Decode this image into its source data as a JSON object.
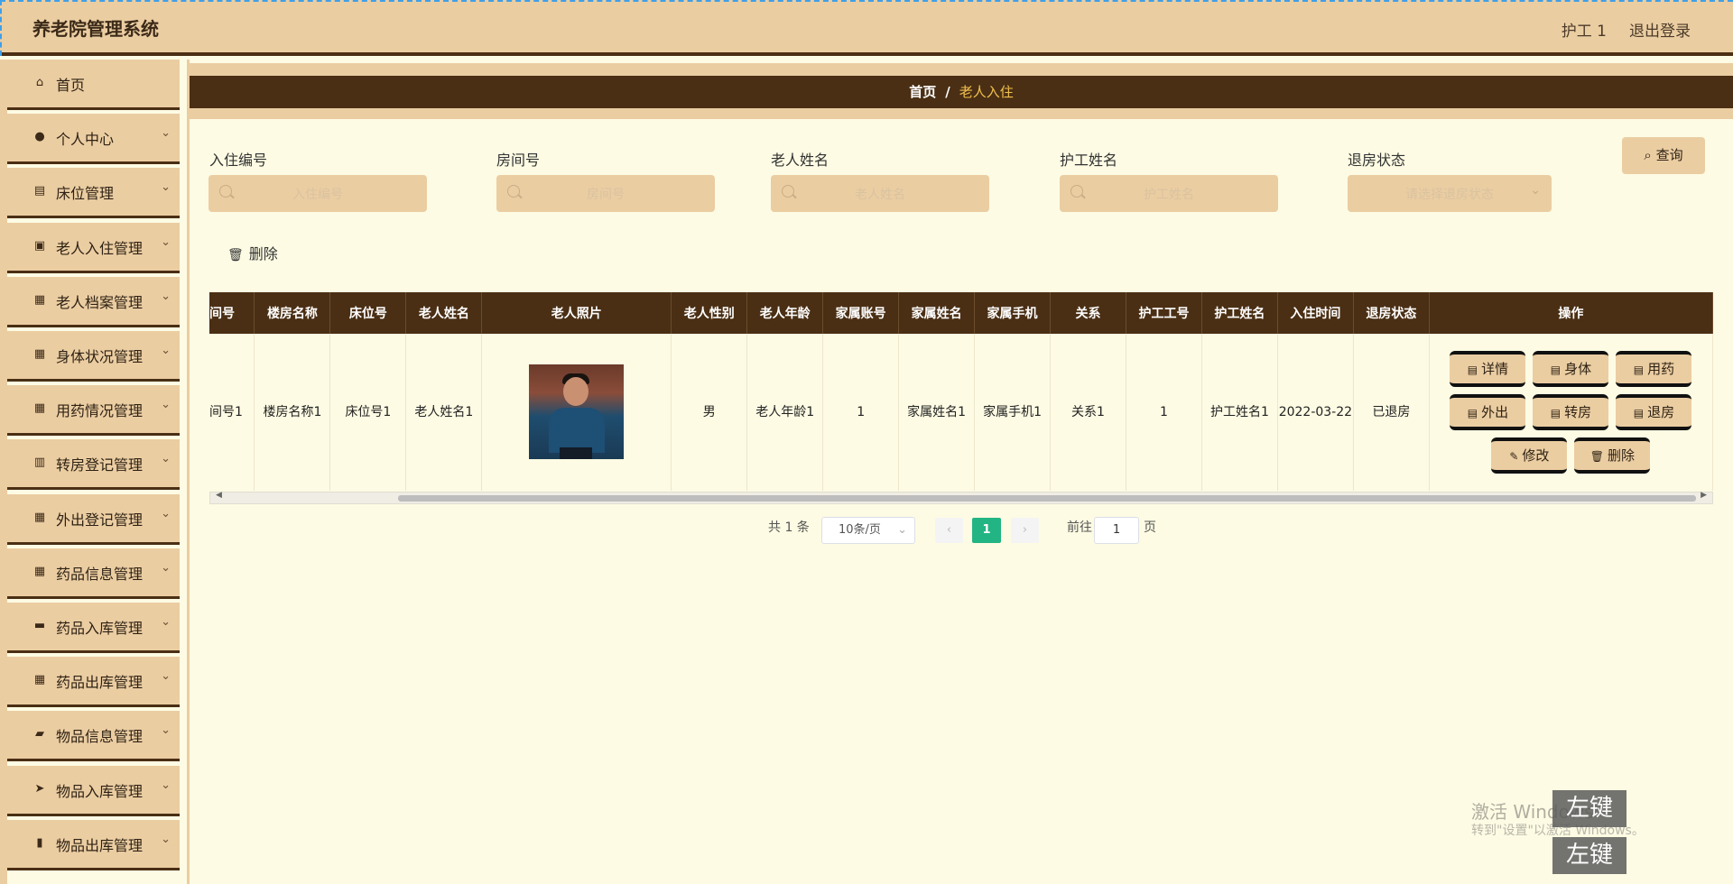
{
  "header": {
    "app_title": "养老院管理系统",
    "user": "护工 1",
    "logout": "退出登录"
  },
  "sidebar": {
    "items": [
      {
        "label": "首页",
        "icon": "home-icon",
        "glyph": "⌂",
        "has_chevron": false
      },
      {
        "label": "个人中心",
        "icon": "user-icon",
        "glyph": "●",
        "has_chevron": true
      },
      {
        "label": "床位管理",
        "icon": "chart-icon",
        "glyph": "▤",
        "has_chevron": true
      },
      {
        "label": "老人入住管理",
        "icon": "clipboard-icon",
        "glyph": "▣",
        "has_chevron": true
      },
      {
        "label": "老人档案管理",
        "icon": "grid-icon",
        "glyph": "▦",
        "has_chevron": true
      },
      {
        "label": "身体状况管理",
        "icon": "grid-icon",
        "glyph": "▦",
        "has_chevron": true
      },
      {
        "label": "用药情况管理",
        "icon": "grid-icon",
        "glyph": "▦",
        "has_chevron": true
      },
      {
        "label": "转房登记管理",
        "icon": "library-icon",
        "glyph": "▥",
        "has_chevron": true
      },
      {
        "label": "外出登记管理",
        "icon": "grid-icon",
        "glyph": "▦",
        "has_chevron": true
      },
      {
        "label": "药品信息管理",
        "icon": "grid-icon",
        "glyph": "▦",
        "has_chevron": true
      },
      {
        "label": "药品入库管理",
        "icon": "monitor-icon",
        "glyph": "▬",
        "has_chevron": true
      },
      {
        "label": "药品出库管理",
        "icon": "grid-icon",
        "glyph": "▦",
        "has_chevron": true
      },
      {
        "label": "物品信息管理",
        "icon": "briefcase-icon",
        "glyph": "▰",
        "has_chevron": true
      },
      {
        "label": "物品入库管理",
        "icon": "send-icon",
        "glyph": "➤",
        "has_chevron": true
      },
      {
        "label": "物品出库管理",
        "icon": "clipboard-icon",
        "glyph": "▮",
        "has_chevron": true
      }
    ]
  },
  "breadcrumb": {
    "home": "首页",
    "separator": "/",
    "current": "老人入住"
  },
  "search": {
    "fields": [
      {
        "label": "入住编号",
        "placeholder": "入住编号",
        "type": "text"
      },
      {
        "label": "房间号",
        "placeholder": "房间号",
        "type": "text"
      },
      {
        "label": "老人姓名",
        "placeholder": "老人姓名",
        "type": "text"
      },
      {
        "label": "护工姓名",
        "placeholder": "护工姓名",
        "type": "text"
      },
      {
        "label": "退房状态",
        "placeholder": "请选择退房状态",
        "type": "select"
      }
    ],
    "query_button": "查询",
    "delete_button": "删除"
  },
  "table": {
    "columns": [
      "间号",
      "楼房名称",
      "床位号",
      "老人姓名",
      "老人照片",
      "老人性别",
      "老人年龄",
      "家属账号",
      "家属姓名",
      "家属手机",
      "关系",
      "护工工号",
      "护工姓名",
      "入住时间",
      "退房状态",
      "操作"
    ],
    "row": {
      "room": "间号1",
      "building": "楼房名称1",
      "bed": "床位号1",
      "name": "老人姓名1",
      "gender": "男",
      "age": "老人年龄1",
      "family_account": "1",
      "family_name": "家属姓名1",
      "family_phone": "家属手机1",
      "relation": "关系1",
      "worker_id": "1",
      "worker_name": "护工姓名1",
      "checkin": "2022-03-22",
      "status": "已退房"
    },
    "actions": [
      "详情",
      "身体",
      "用药",
      "外出",
      "转房",
      "退房",
      "修改",
      "删除"
    ]
  },
  "pagination": {
    "total": "共 1 条",
    "page_size": "10条/页",
    "current_page": "1",
    "goto_prefix": "前往",
    "goto_value": "1",
    "goto_suffix": "页"
  },
  "watermark": {
    "line1": "激活 Windows",
    "line2": "转到\"设置\"以激活 Windows。",
    "key_label": "左键"
  },
  "colors": {
    "accent_dark": "#4a2f14",
    "accent_light": "#ebcda2",
    "background": "#fdfbe3",
    "page_active": "#22b583"
  }
}
